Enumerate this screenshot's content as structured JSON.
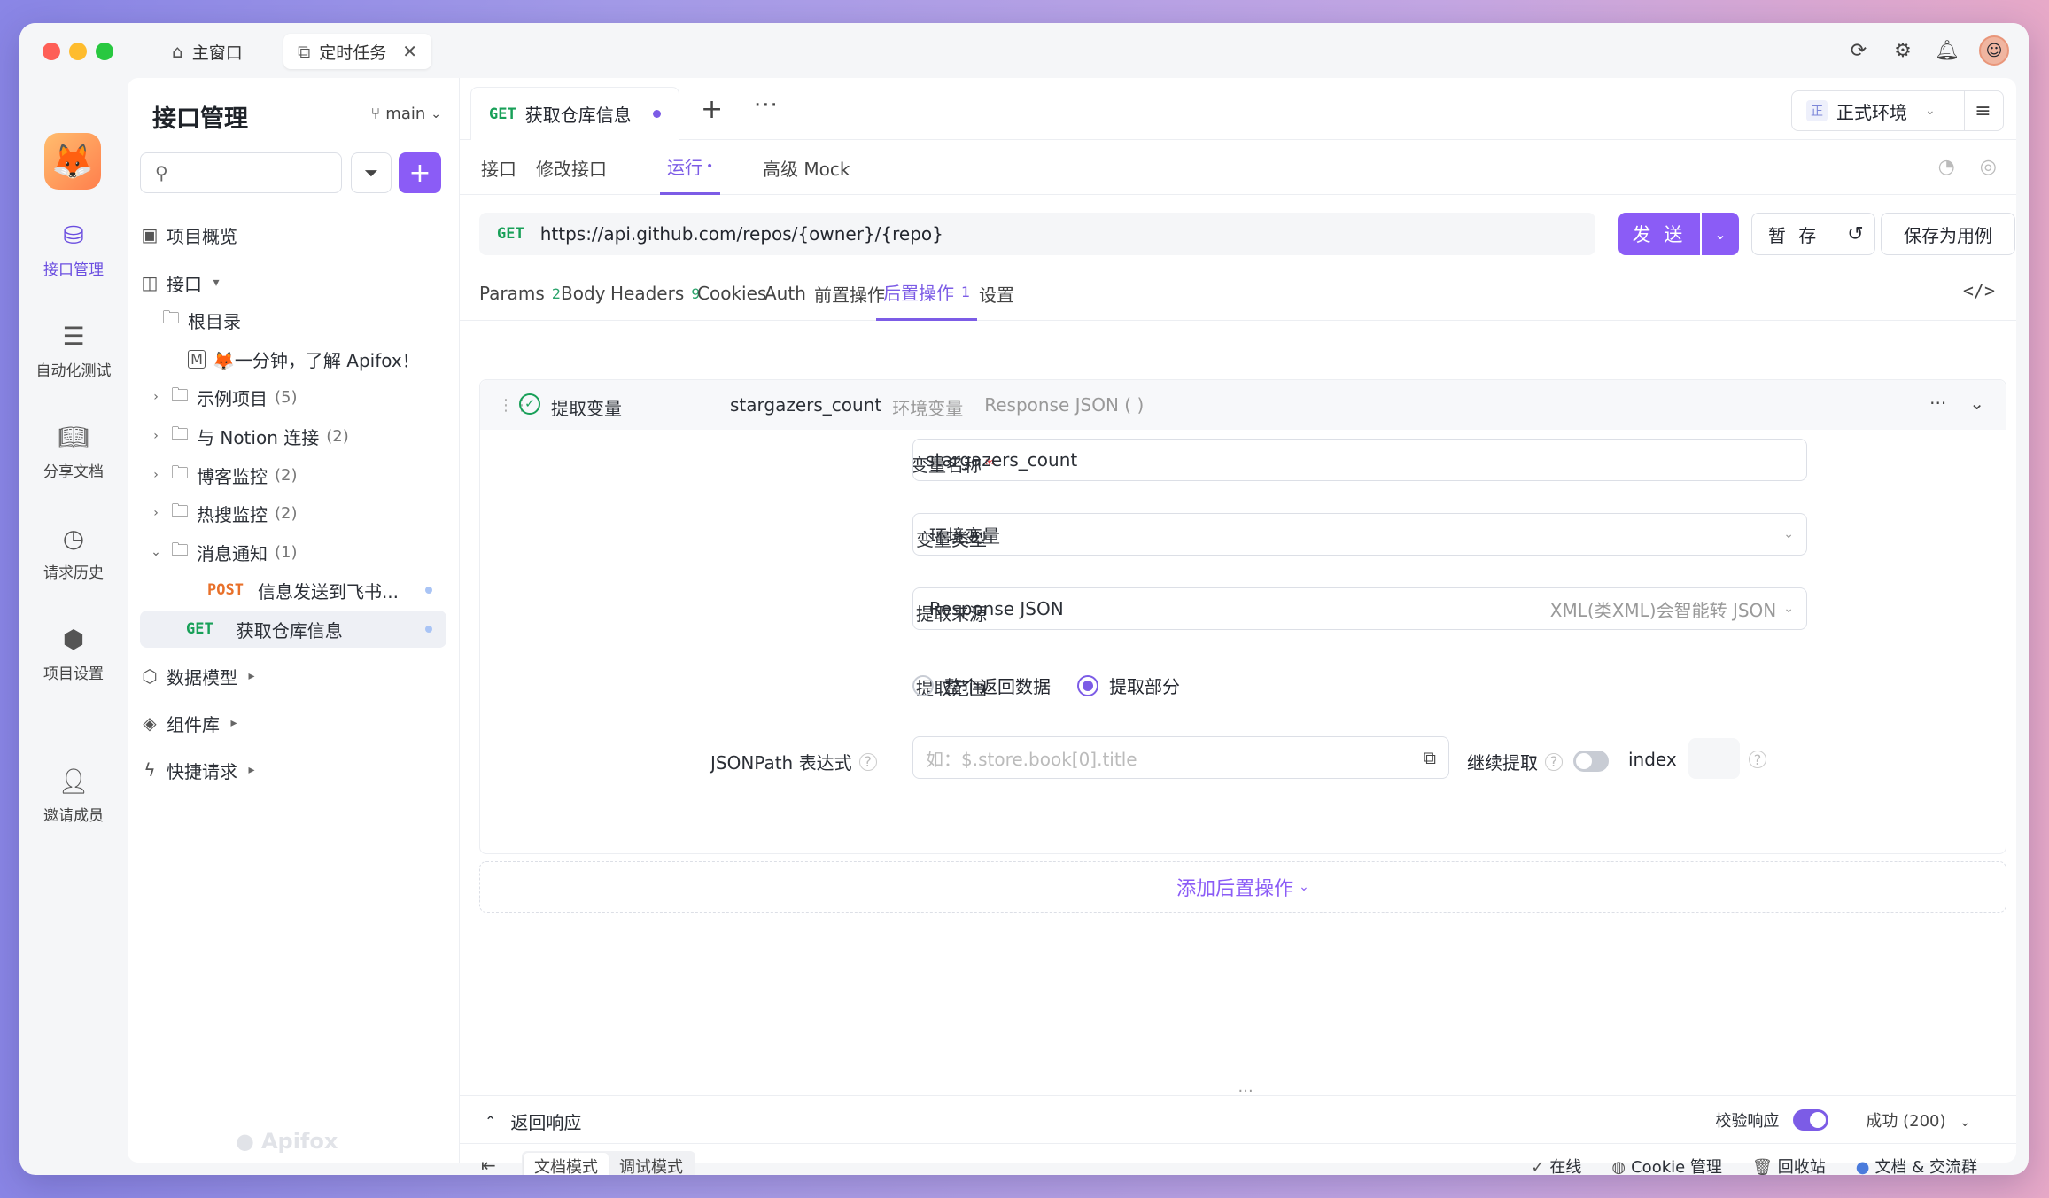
{
  "window_tabs": [
    {
      "label": "主窗口",
      "icon": "home-icon"
    },
    {
      "label": "定时任务",
      "icon": "external-link-icon"
    }
  ],
  "rail": [
    {
      "label": "接口管理",
      "icon": "api-icon"
    },
    {
      "label": "自动化测试",
      "icon": "stack-icon"
    },
    {
      "label": "分享文档",
      "icon": "book-icon"
    },
    {
      "label": "请求历史",
      "icon": "clock-icon"
    },
    {
      "label": "项目设置",
      "icon": "hexagon-gear-icon"
    },
    {
      "label": "邀请成员",
      "icon": "user-plus-icon"
    }
  ],
  "sidebar": {
    "title": "接口管理",
    "branch": "main",
    "overview": "项目概览",
    "api_root": "接口",
    "root_dir": "根目录",
    "intro_doc": "🦊一分钟，了解 Apifox！",
    "folders": [
      {
        "name": "示例项目",
        "count": "(5)"
      },
      {
        "name": "与 Notion 连接",
        "count": "(2)"
      },
      {
        "name": "博客监控",
        "count": "(2)"
      },
      {
        "name": "热搜监控",
        "count": "(2)"
      },
      {
        "name": "消息通知",
        "count": "(1)"
      }
    ],
    "post_item": {
      "method": "POST",
      "name": "信息发送到飞书..."
    },
    "get_item": {
      "method": "GET",
      "name": "获取仓库信息"
    },
    "data_model": "数据模型",
    "components": "组件库",
    "quick_req": "快捷请求",
    "watermark": "Apifox"
  },
  "tabs": {
    "req_tab_method": "GET",
    "req_tab_name": "获取仓库信息",
    "env": "正式环境",
    "env_badge": "正"
  },
  "sub_tabs": [
    "接口",
    "修改接口",
    "运行",
    "高级 Mock"
  ],
  "url": {
    "method": "GET",
    "value": "https://api.github.com/repos/{owner}/{repo}"
  },
  "buttons": {
    "send": "发 送",
    "save": "暂 存",
    "save_case": "保存为用例"
  },
  "param_tabs": [
    {
      "label": "Params",
      "count": "2"
    },
    {
      "label": "Body",
      "count": ""
    },
    {
      "label": "Headers",
      "count": "9"
    },
    {
      "label": "Cookies",
      "count": ""
    },
    {
      "label": "Auth",
      "count": ""
    },
    {
      "label": "前置操作",
      "count": ""
    },
    {
      "label": "后置操作",
      "count": "1"
    },
    {
      "label": "设置",
      "count": ""
    }
  ],
  "post_op": {
    "title": "提取变量",
    "summary_var": "stargazers_count",
    "summary_type": "环境变量",
    "summary_source": "Response JSON ( )",
    "var_name_label": "变量名称",
    "var_name_value": "stargazers_count",
    "var_type_label": "变量类型",
    "var_type_value": "环境变量",
    "source_label": "提取来源",
    "source_value": "Response JSON",
    "source_hint": "XML(类XML)会智能转 JSON",
    "range_label": "提取范围",
    "range_all": "整个返回数据",
    "range_part": "提取部分",
    "jsonpath_label": "JSONPath 表达式",
    "jsonpath_placeholder": "如：$.store.book[0].title",
    "continue_label": "继续提取",
    "index_label": "index"
  },
  "add_post": "添加后置操作",
  "response": {
    "title": "返回响应",
    "validate_label": "校验响应",
    "status": "成功 (200)"
  },
  "footer": {
    "doc_mode": "文档模式",
    "debug_mode": "调试模式",
    "online": "在线",
    "cookie": "Cookie 管理",
    "trash": "回收站",
    "docs": "文档 & 交流群"
  },
  "colors": {
    "accent": "#8b5cf6",
    "get": "#18a058",
    "post": "#e8702a"
  }
}
